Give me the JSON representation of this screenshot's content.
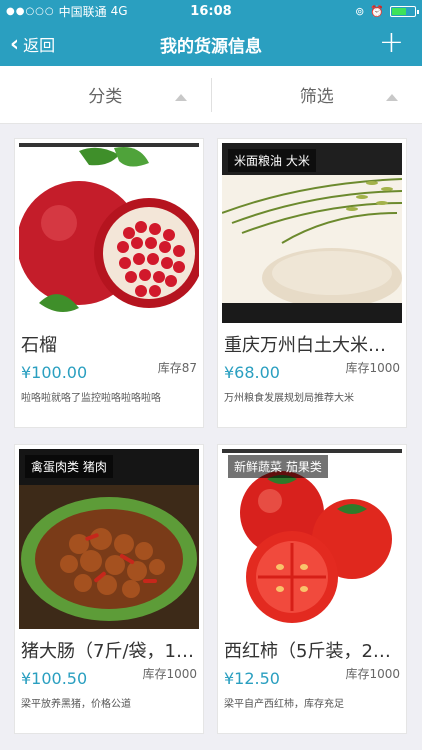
{
  "statusbar": {
    "carrier": "中国联通",
    "network": "4G",
    "time": "16:08"
  },
  "navbar": {
    "back_label": "返回",
    "title": "我的货源信息",
    "add_label": "+"
  },
  "filters": {
    "category_label": "分类",
    "filter_label": "筛选"
  },
  "products": [
    {
      "name": "石榴",
      "price": "¥100.00",
      "stock": "库存87",
      "description": "啦咯啦就咯了监控啦咯啦咯啦咯",
      "category": "",
      "icon": "pomegranate-image"
    },
    {
      "name": "重庆万州白土大米…",
      "price": "¥68.00",
      "stock": "库存1000",
      "description": "万州粮食发展规划局推荐大米",
      "category": "米面粮油 大米",
      "icon": "rice-image"
    },
    {
      "name": "猪大肠（7斤/袋，1…",
      "price": "¥100.50",
      "stock": "库存1000",
      "description": "梁平放养黑猪，价格公道",
      "category": "禽蛋肉类 猪肉",
      "icon": "pork-dish-image"
    },
    {
      "name": "西红柿（5斤装，2…",
      "price": "¥12.50",
      "stock": "库存1000",
      "description": "梁平自产西红柿，库存充足",
      "category": "新鲜蔬菜 茄果类",
      "icon": "tomato-image"
    }
  ]
}
